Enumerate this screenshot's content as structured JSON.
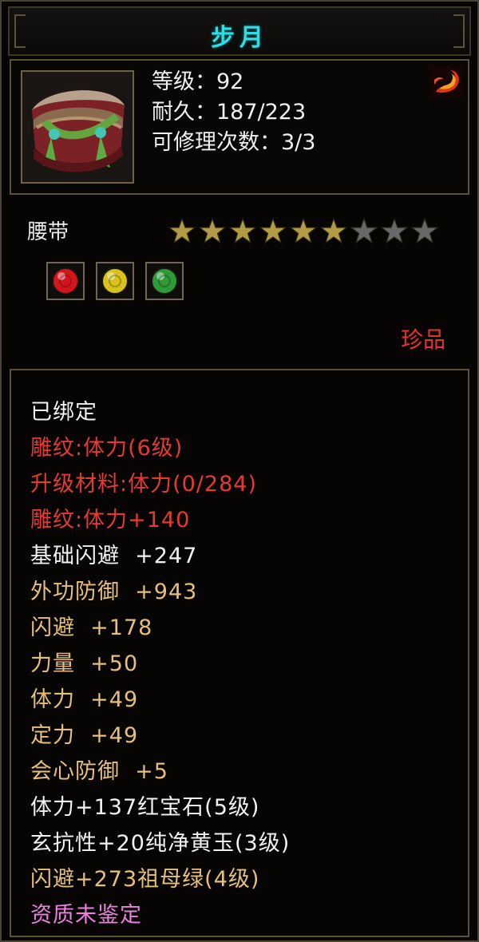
{
  "item": {
    "name": "步月",
    "level": "等级：92",
    "durability": "耐久：187/223",
    "repairs": "可修理次数：3/3",
    "slot": "腰带",
    "quality": "珍品",
    "stars_total": 9,
    "stars_filled": 6,
    "icon": "belt-icon",
    "class_icon": "fire-icon"
  },
  "gems": [
    {
      "icon": "ruby-gem-icon",
      "color": "#d4161c"
    },
    {
      "icon": "yellow-jade-gem-icon",
      "color": "#d7c319"
    },
    {
      "icon": "emerald-gem-icon",
      "color": "#2f9b36"
    }
  ],
  "attributes": [
    {
      "text": "已绑定",
      "color": "white"
    },
    {
      "text": "雕纹:体力(6级)",
      "color": "red"
    },
    {
      "text": "升级材料:体力(0/284)",
      "color": "red"
    },
    {
      "text": "雕纹:体力+140",
      "color": "red"
    },
    {
      "text": "基础闪避  +247",
      "color": "white"
    },
    {
      "text": "外功防御  +943",
      "color": "gold"
    },
    {
      "text": "闪避  +178",
      "color": "gold"
    },
    {
      "text": "力量  +50",
      "color": "gold"
    },
    {
      "text": "体力  +49",
      "color": "gold"
    },
    {
      "text": "定力  +49",
      "color": "gold"
    },
    {
      "text": "会心防御  +5",
      "color": "gold"
    },
    {
      "text": "体力+137红宝石(5级)",
      "color": "white"
    },
    {
      "text": "玄抗性+20纯净黄玉(3级)",
      "color": "white"
    },
    {
      "text": "闪避+273祖母绿(4级)",
      "color": "gold"
    },
    {
      "text": "资质未鉴定",
      "color": "purple"
    }
  ],
  "colors": {
    "title": "#33dce2",
    "red": "#e43a32",
    "gold": "#e6c07a",
    "purple": "#ea80e0",
    "star_filled": "#b19c45",
    "star_empty": "#68676a"
  }
}
